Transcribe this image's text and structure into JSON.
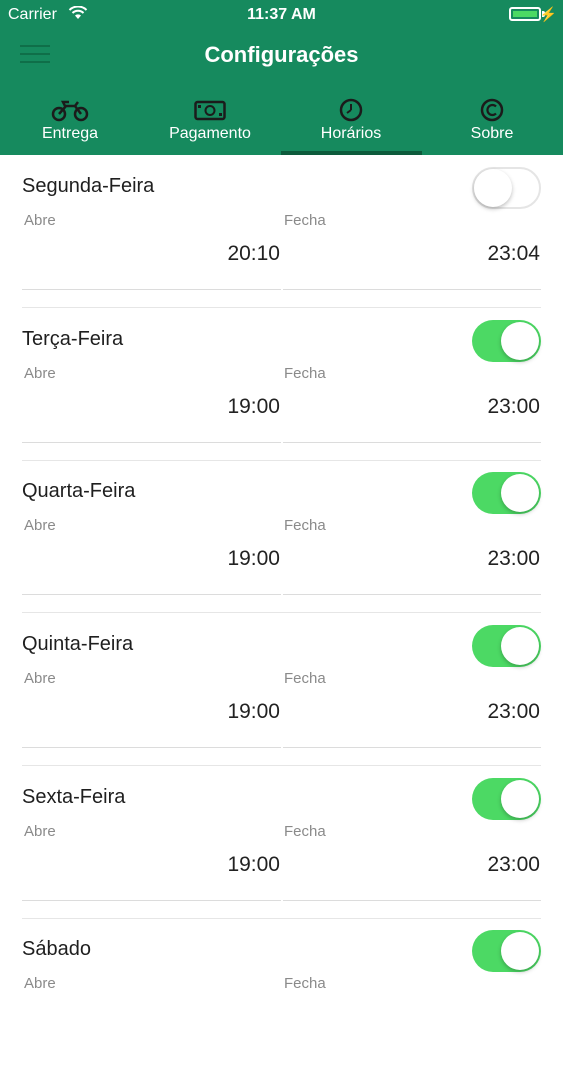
{
  "status_bar": {
    "carrier": "Carrier",
    "time": "11:37 AM",
    "battery_percent": 100
  },
  "header": {
    "title": "Configurações"
  },
  "tabs": [
    {
      "label": "Entrega",
      "icon": "motorcycle-icon",
      "active": false
    },
    {
      "label": "Pagamento",
      "icon": "banknote-icon",
      "active": false
    },
    {
      "label": "Horários",
      "icon": "clock-icon",
      "active": true
    },
    {
      "label": "Sobre",
      "icon": "copyright-icon",
      "active": false
    }
  ],
  "schedule": {
    "open_label": "Abre",
    "close_label": "Fecha",
    "days": [
      {
        "name": "Segunda-Feira",
        "enabled": false,
        "open": "20:10",
        "close": "23:04"
      },
      {
        "name": "Terça-Feira",
        "enabled": true,
        "open": "19:00",
        "close": "23:00"
      },
      {
        "name": "Quarta-Feira",
        "enabled": true,
        "open": "19:00",
        "close": "23:00"
      },
      {
        "name": "Quinta-Feira",
        "enabled": true,
        "open": "19:00",
        "close": "23:00"
      },
      {
        "name": "Sexta-Feira",
        "enabled": true,
        "open": "19:00",
        "close": "23:00"
      },
      {
        "name": "Sábado",
        "enabled": true,
        "open": "",
        "close": ""
      }
    ]
  },
  "colors": {
    "header": "#168a5e",
    "accent_toggle": "#4cd964",
    "tab_indicator": "#0d5b3c"
  }
}
